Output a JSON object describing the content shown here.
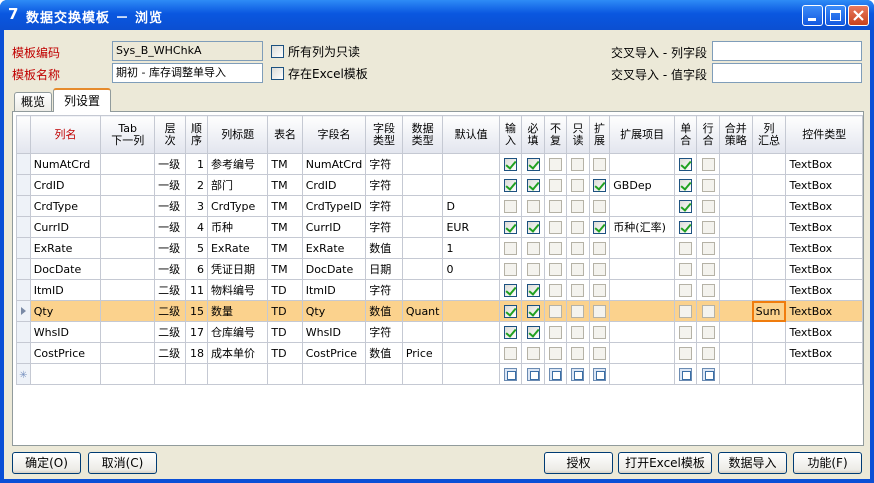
{
  "window": {
    "title": "数据交换模板 － 浏览",
    "icon_glyph": "7"
  },
  "form": {
    "code_label": "模板编码",
    "code_value": "Sys_B_WHChkA",
    "name_label": "模板名称",
    "name_value": "期初 - 库存调整单导入",
    "readonly_label": "所有列为只读",
    "readonly_checked": false,
    "excel_label": "存在Excel模板",
    "excel_checked": false,
    "cross_col_label": "交叉导入 - 列字段",
    "cross_col_value": "",
    "cross_val_label": "交叉导入 - 值字段",
    "cross_val_value": ""
  },
  "tabs": [
    {
      "label": "概览",
      "active": false
    },
    {
      "label": "列设置",
      "active": true
    }
  ],
  "grid": {
    "headers": [
      "列名",
      "Tab\n下一列",
      "层\n次",
      "顺\n序",
      "列标题",
      "表名",
      "字段名",
      "字段\n类型",
      "数据\n类型",
      "默认值",
      "输\n入",
      "必\n填",
      "不\n复",
      "只\n读",
      "扩\n展",
      "扩展项目",
      "单\n合",
      "行\n合",
      "合并\n策略",
      "列\n汇总",
      "控件类型"
    ],
    "rows": [
      {
        "name": "NumAtCrd",
        "level": "一级",
        "order": "1",
        "title": "参考编号",
        "table": "TM",
        "field": "NumAtCrd",
        "ftype": "字符",
        "dtype": "",
        "default": "",
        "input": true,
        "required": true,
        "nodup": false,
        "readonly": false,
        "extend": false,
        "ext_item": "",
        "single": true,
        "rowmerge": false,
        "summary": "",
        "control": "TextBox"
      },
      {
        "name": "CrdID",
        "level": "一级",
        "order": "2",
        "title": "部门",
        "table": "TM",
        "field": "CrdID",
        "ftype": "字符",
        "dtype": "",
        "default": "",
        "input": true,
        "required": true,
        "nodup": false,
        "readonly": false,
        "extend": true,
        "ext_item": "GBDep",
        "single": true,
        "rowmerge": false,
        "summary": "",
        "control": "TextBox"
      },
      {
        "name": "CrdType",
        "level": "一级",
        "order": "3",
        "title": "CrdType",
        "table": "TM",
        "field": "CrdTypeID",
        "ftype": "字符",
        "dtype": "",
        "default": "D",
        "input": false,
        "required": false,
        "nodup": false,
        "readonly": false,
        "extend": false,
        "ext_item": "",
        "single": true,
        "rowmerge": false,
        "summary": "",
        "control": "TextBox"
      },
      {
        "name": "CurrID",
        "level": "一级",
        "order": "4",
        "title": "币种",
        "table": "TM",
        "field": "CurrID",
        "ftype": "字符",
        "dtype": "",
        "default": "EUR",
        "input": true,
        "required": true,
        "nodup": false,
        "readonly": false,
        "extend": true,
        "ext_item": "币种(汇率)",
        "single": true,
        "rowmerge": false,
        "summary": "",
        "control": "TextBox"
      },
      {
        "name": "ExRate",
        "level": "一级",
        "order": "5",
        "title": "ExRate",
        "table": "TM",
        "field": "ExRate",
        "ftype": "数值",
        "dtype": "",
        "default": "1",
        "input": false,
        "required": false,
        "nodup": false,
        "readonly": false,
        "extend": false,
        "ext_item": "",
        "single": false,
        "rowmerge": false,
        "summary": "",
        "control": "TextBox"
      },
      {
        "name": "DocDate",
        "level": "一级",
        "order": "6",
        "title": "凭证日期",
        "table": "TM",
        "field": "DocDate",
        "ftype": "日期",
        "dtype": "",
        "default": "0",
        "input": false,
        "required": false,
        "nodup": false,
        "readonly": false,
        "extend": false,
        "ext_item": "",
        "single": false,
        "rowmerge": false,
        "summary": "",
        "control": "TextBox"
      },
      {
        "name": "ItmID",
        "level": "二级",
        "order": "11",
        "title": "物料编号",
        "table": "TD",
        "field": "ItmID",
        "ftype": "字符",
        "dtype": "",
        "default": "",
        "input": true,
        "required": true,
        "nodup": false,
        "readonly": false,
        "extend": false,
        "ext_item": "",
        "single": false,
        "rowmerge": false,
        "summary": "",
        "control": "TextBox"
      },
      {
        "name": "Qty",
        "level": "二级",
        "order": "15",
        "title": "数量",
        "table": "TD",
        "field": "Qty",
        "ftype": "数值",
        "dtype": "Quant",
        "default": "",
        "input": true,
        "required": true,
        "nodup": false,
        "readonly": false,
        "extend": false,
        "ext_item": "",
        "single": false,
        "rowmerge": false,
        "summary": "Sum",
        "control": "TextBox",
        "current": true
      },
      {
        "name": "WhsID",
        "level": "二级",
        "order": "17",
        "title": "仓库编号",
        "table": "TD",
        "field": "WhsID",
        "ftype": "字符",
        "dtype": "",
        "default": "",
        "input": true,
        "required": true,
        "nodup": false,
        "readonly": false,
        "extend": false,
        "ext_item": "",
        "single": false,
        "rowmerge": false,
        "summary": "",
        "control": "TextBox"
      },
      {
        "name": "CostPrice",
        "level": "二级",
        "order": "18",
        "title": "成本单价",
        "table": "TD",
        "field": "CostPrice",
        "ftype": "数值",
        "dtype": "Price",
        "default": "",
        "input": false,
        "required": false,
        "nodup": false,
        "readonly": false,
        "extend": false,
        "ext_item": "",
        "single": false,
        "rowmerge": false,
        "summary": "",
        "control": "TextBox"
      }
    ]
  },
  "buttons": {
    "ok": "确定(O)",
    "cancel": "取消(C)",
    "authorize": "授权",
    "open_excel": "打开Excel模板",
    "import": "数据导入",
    "function": "功能(F)"
  }
}
